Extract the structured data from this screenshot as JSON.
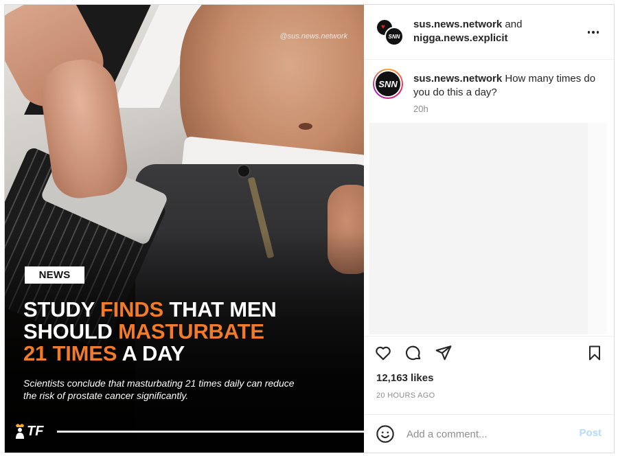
{
  "media": {
    "watermark": "@sus.news.network",
    "tag": "NEWS",
    "headline": {
      "line1_a": "STUDY ",
      "line1_b": "FINDS",
      "line1_c": " THAT MEN",
      "line2_a": "SHOULD ",
      "line2_b": "MASTURBATE",
      "line3_a": "21 TIMES",
      "line3_b": " A DAY"
    },
    "subhead": "Scientists conclude that masturbating 21 times daily can reduce the risk of prostate cancer significantly.",
    "logo": "TF",
    "accent_color": "#ef7b2b"
  },
  "header": {
    "user1": "sus.news.network",
    "joiner": " and",
    "user2": "nigga.news.explicit",
    "avatar_text": "SNN",
    "more_icon": "more-horizontal-icon"
  },
  "caption": {
    "avatar_text": "SNN",
    "username": "sus.news.network",
    "text": " How many times do you do this a day?",
    "time": "20h"
  },
  "actions": {
    "like_icon": "heart-icon",
    "comment_icon": "comment-icon",
    "share_icon": "paper-plane-icon",
    "save_icon": "bookmark-icon"
  },
  "likes": "12,163 likes",
  "timeago": "20 HOURS AGO",
  "comment_box": {
    "placeholder": "Add a comment...",
    "post_label": "Post",
    "post_color": "#b3dbff"
  }
}
